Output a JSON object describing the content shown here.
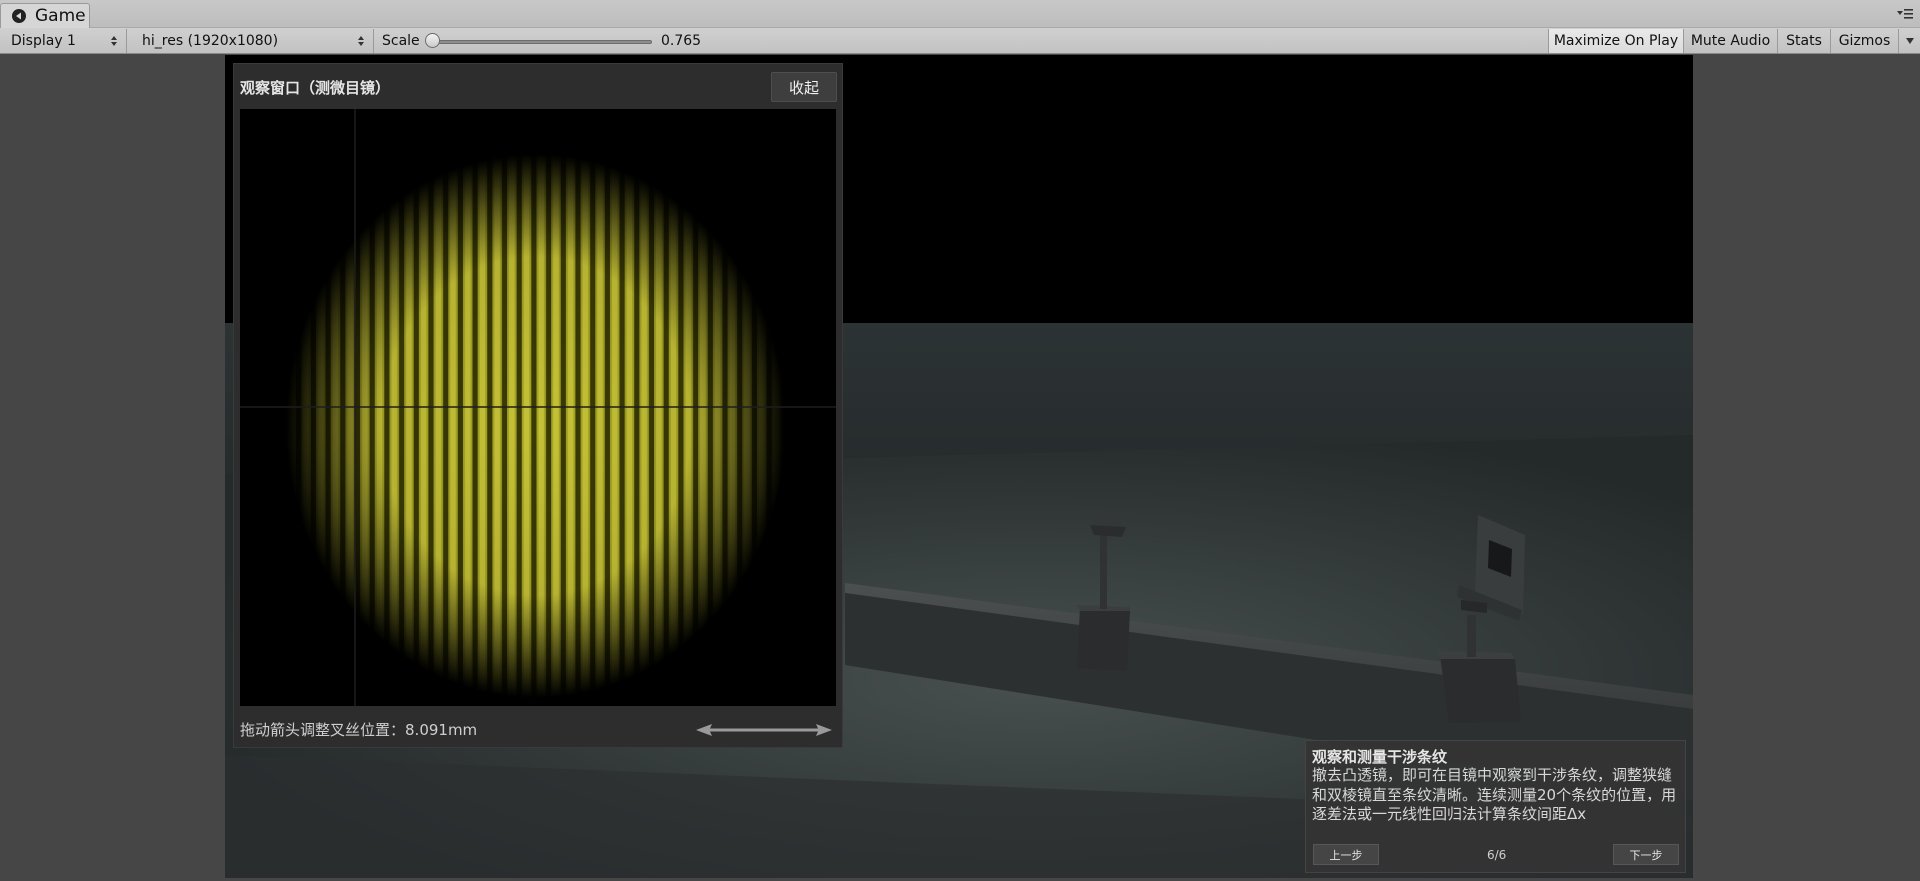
{
  "window": {
    "tab_title": "Game",
    "unity_icon": "unity-logo-icon",
    "menu_icon": "window-menu-icon"
  },
  "toolbar": {
    "display": "Display 1",
    "resolution": "hi_res (1920x1080)",
    "scale_label": "Scale",
    "scale_value": "0.765",
    "maximize_on_play": "Maximize On Play",
    "mute_audio": "Mute Audio",
    "stats": "Stats",
    "gizmos": "Gizmos"
  },
  "observation": {
    "title": "观察窗口（测微目镜）",
    "collapse_label": "收起",
    "drag_hint": "拖动箭头调整叉丝位置：8.091mm",
    "fringe_color": "#d8d42a"
  },
  "step": {
    "title": "观察和测量干涉条纹",
    "description": "撤去凸透镜，即可在目镜中观察到干涉条纹，调整狭缝和双棱镜直至条纹清晰。连续测量20个条纹的位置，用逐差法或一元线性回归法计算条纹间距Δx",
    "prev_label": "上一步",
    "next_label": "下一步",
    "counter": "6/6"
  }
}
